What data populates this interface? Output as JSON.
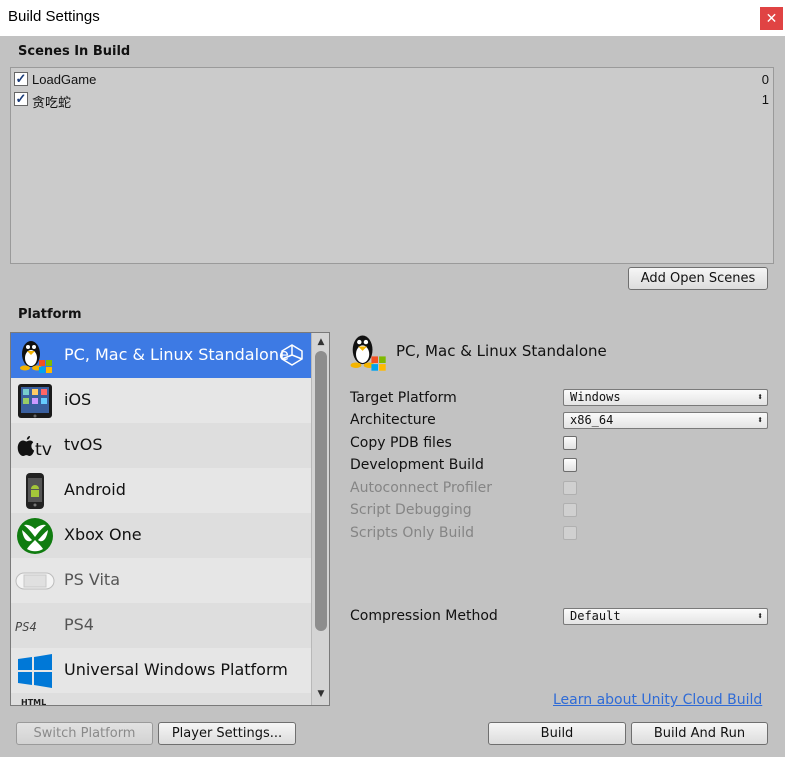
{
  "window": {
    "title": "Build Settings",
    "close_glyph": "✕"
  },
  "scenes": {
    "label": "Scenes In Build",
    "items": [
      {
        "name": "LoadGame",
        "index": "0",
        "checked": true
      },
      {
        "name": "贪吃蛇",
        "index": "1",
        "checked": true
      }
    ],
    "add_open_scenes_label": "Add Open Scenes"
  },
  "platform": {
    "label": "Platform",
    "items": [
      {
        "label": "PC, Mac & Linux Standalone",
        "icon": "linux-penguin-icon",
        "selected": true
      },
      {
        "label": "iOS",
        "icon": "ipad-icon"
      },
      {
        "label": "tvOS",
        "icon": "apple-tv-icon"
      },
      {
        "label": "Android",
        "icon": "android-phone-icon"
      },
      {
        "label": "Xbox One",
        "icon": "xbox-icon"
      },
      {
        "label": "PS Vita",
        "icon": "ps-vita-icon"
      },
      {
        "label": "PS4",
        "icon": "ps4-icon"
      },
      {
        "label": "Universal Windows Platform",
        "icon": "windows-icon"
      }
    ],
    "icon_text": {
      "tv": "tv",
      "ps4": "PS4",
      "html": "HTML"
    }
  },
  "settings": {
    "header": "PC, Mac & Linux Standalone",
    "target_platform": {
      "label": "Target Platform",
      "value": "Windows"
    },
    "architecture": {
      "label": "Architecture",
      "value": "x86_64"
    },
    "copy_pdb": {
      "label": "Copy PDB files",
      "checked": false
    },
    "development_build": {
      "label": "Development Build",
      "checked": false
    },
    "autoconnect_profiler": {
      "label": "Autoconnect Profiler",
      "checked": false,
      "disabled": true
    },
    "script_debugging": {
      "label": "Script Debugging",
      "checked": false,
      "disabled": true
    },
    "scripts_only_build": {
      "label": "Scripts Only Build",
      "checked": false,
      "disabled": true
    },
    "compression_method": {
      "label": "Compression Method",
      "value": "Default"
    },
    "dropdown_caret": "⬍"
  },
  "footer": {
    "cloud_link": "Learn about Unity Cloud Build",
    "switch_platform": "Switch Platform",
    "player_settings": "Player Settings...",
    "build": "Build",
    "build_and_run": "Build And Run"
  },
  "colors": {
    "selection": "#3d7ae4",
    "link": "#2f6bd6",
    "close_button": "#e04343",
    "xbox_green": "#107c10",
    "windows_blue": "#0078d7"
  }
}
